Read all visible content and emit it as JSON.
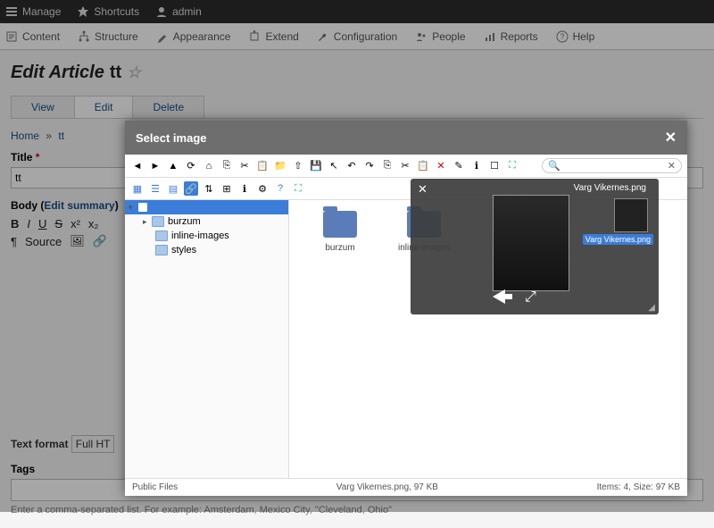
{
  "topbar": {
    "manage": "Manage",
    "shortcuts": "Shortcuts",
    "admin": "admin"
  },
  "secondnav": {
    "content": "Content",
    "structure": "Structure",
    "appearance": "Appearance",
    "extend": "Extend",
    "configuration": "Configuration",
    "people": "People",
    "reports": "Reports",
    "help": "Help"
  },
  "page": {
    "title_prefix": "Edit Article",
    "title_value": "tt",
    "tabs": [
      "View",
      "Edit",
      "Delete"
    ],
    "breadcrumb": {
      "home": "Home",
      "current": "tt",
      "sep": "»"
    }
  },
  "form": {
    "title_label": "Title",
    "title_value": "tt",
    "body_label_prefix": "Body (",
    "body_label_link": "Edit summary",
    "body_label_suffix": ")",
    "source_btn": "Source",
    "textformat_label": "Text format",
    "textformat_value": "Full HT",
    "tags_label": "Tags",
    "tags_help": "Enter a comma-separated list. For example: Amsterdam, Mexico City, \"Cleveland, Ohio\""
  },
  "modal": {
    "title": "Select image",
    "search_placeholder": "",
    "tree": {
      "root": "",
      "items": [
        "burzum",
        "inline-images",
        "styles"
      ]
    },
    "files": [
      "burzum",
      "inline-images"
    ],
    "footer_left": "Public Files",
    "footer_center": "Varg Vikernes.png, 97 KB",
    "footer_right": "Items: 4, Size: 97 KB"
  },
  "preview": {
    "filename": "Varg Vikernes.png",
    "thumb_label": "Varg Vikernes.png"
  }
}
